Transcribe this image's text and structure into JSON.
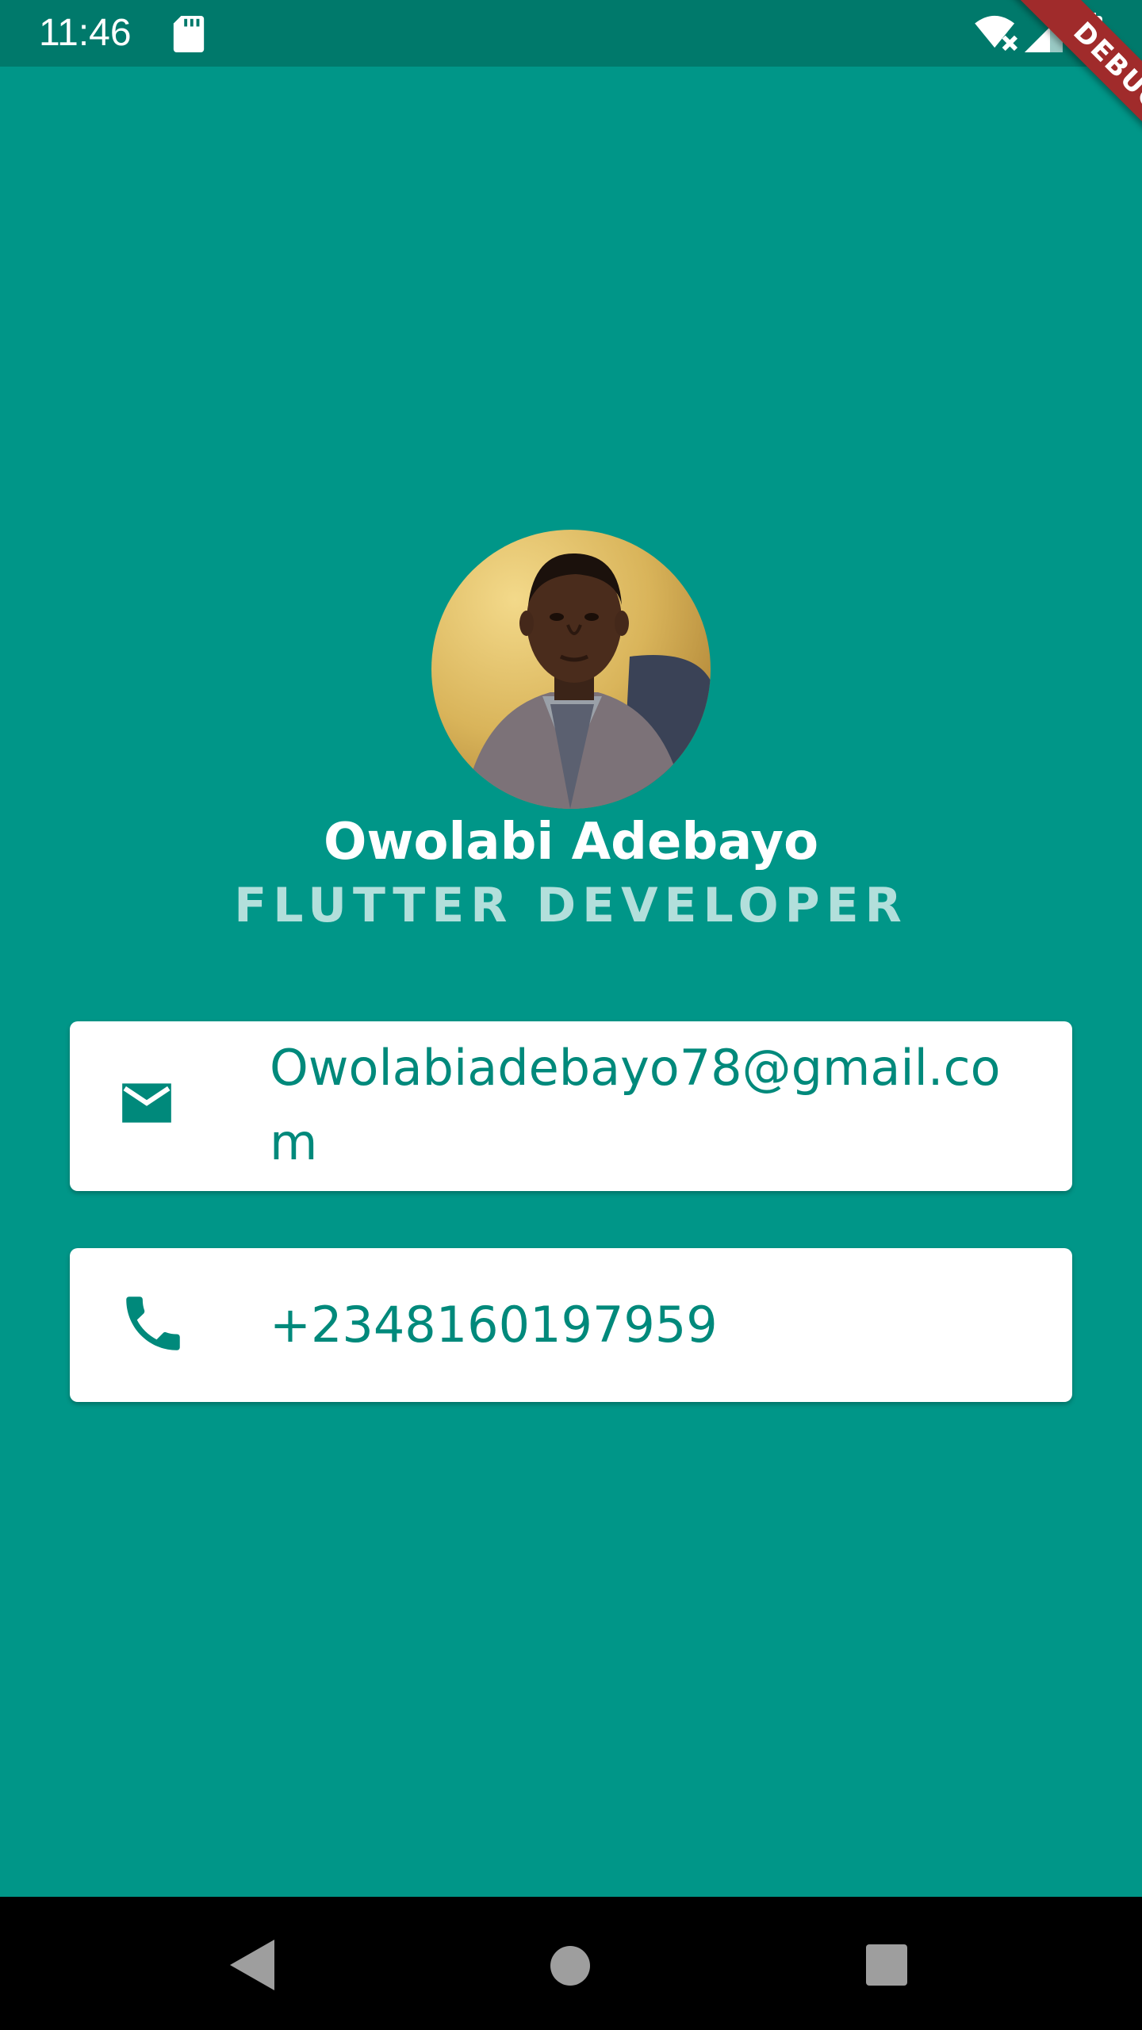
{
  "status_bar": {
    "time": "11:46",
    "icons": [
      "sd-card-icon",
      "wifi-icon",
      "signal-icon",
      "battery-icon"
    ]
  },
  "debug_banner": {
    "label": "DEBUG"
  },
  "profile": {
    "name": "Owolabi Adebayo",
    "title": "FLUTTER DEVELOPER"
  },
  "contacts": {
    "email": {
      "icon": "mail-icon",
      "value": "Owolabiadebayo78@gmail.com"
    },
    "phone": {
      "icon": "phone-icon",
      "value": "+2348160197959"
    }
  },
  "nav_bar": {
    "buttons": [
      "back-icon",
      "home-icon",
      "recent-apps-icon"
    ]
  },
  "colors": {
    "background": "#009688",
    "status_bar": "#00796b",
    "accent_text": "#00897b",
    "subtitle": "#b2dfdb",
    "debug": "#a02b2b"
  }
}
